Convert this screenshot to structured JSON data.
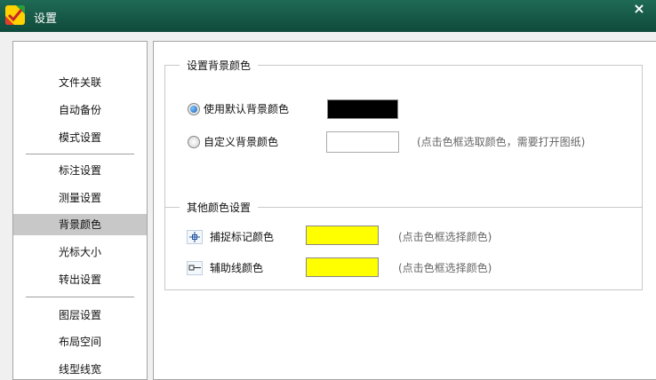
{
  "window": {
    "title": "设置",
    "close_glyph": "×"
  },
  "colors": {
    "titlebar": "#155a47",
    "selected": "#c8c8c8",
    "black_swatch": "#000000",
    "white_swatch": "#ffffff",
    "yellow_swatch": "#ffff00"
  },
  "sidebar": {
    "items": [
      "文件关联",
      "自动备份",
      "模式设置",
      "标注设置",
      "测量设置",
      "背景颜色",
      "光标大小",
      "转出设置",
      "图层设置",
      "布局空间",
      "线型线宽"
    ],
    "active_index": 5
  },
  "background_group": {
    "legend": "设置背景颜色",
    "default_label": "使用默认背景颜色",
    "custom_label": "自定义背景颜色",
    "custom_hint": "(点击色框选取颜色，需要打开图纸)"
  },
  "other_group": {
    "legend": "其他颜色设置",
    "snap_label": "捕捉标记颜色",
    "snap_hint": "(点击色框选择颜色)",
    "aux_label": "辅助线颜色",
    "aux_hint": "(点击色框选择颜色)"
  },
  "icons": {
    "app": "app-logo-icon",
    "snap": "crosshair-icon",
    "aux": "aux-line-icon"
  }
}
